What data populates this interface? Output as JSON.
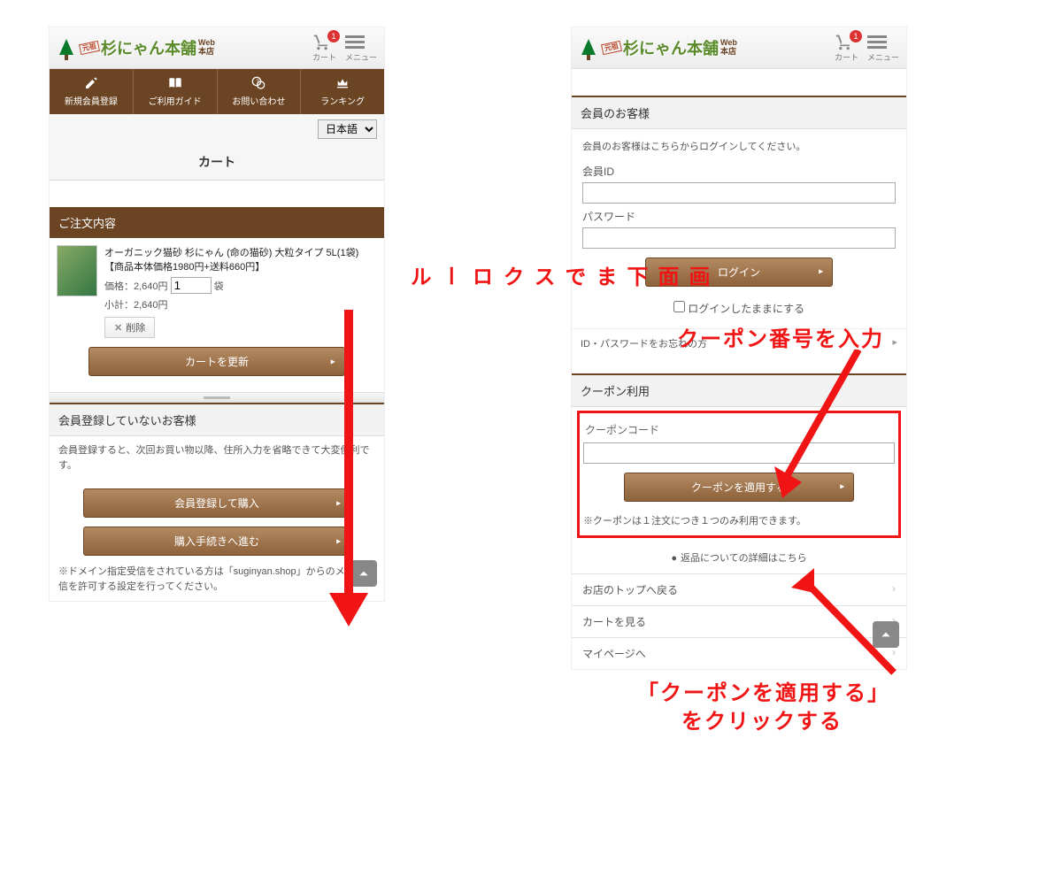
{
  "logo": {
    "prefix": "元祖",
    "main": "杉にゃん本舗",
    "sub_top": "Web",
    "sub_bottom": "本店"
  },
  "topbar": {
    "cart_label": "カート",
    "cart_count": "1",
    "menu_label": "メニュー"
  },
  "nav": {
    "register": "新規会員登録",
    "guide": "ご利用ガイド",
    "contact": "お問い合わせ",
    "ranking": "ランキング"
  },
  "lang": {
    "selected": "日本語"
  },
  "page_title": "カート",
  "order": {
    "heading": "ご注文内容",
    "item_name": "オーガニック猫砂 杉にゃん (命の猫砂) 大粒タイプ 5L(1袋) 【商品本体価格1980円+送料660円】",
    "price_label": "価格：",
    "price": "2,640円",
    "qty": "1",
    "unit": "袋",
    "subtotal_label": "小計：",
    "subtotal": "2,640円",
    "delete_btn": "削除",
    "update_btn": "カートを更新"
  },
  "guest": {
    "heading": "会員登録していないお客様",
    "desc": "会員登録すると、次回お買い物以降、住所入力を省略できて大変便利です。",
    "register_btn": "会員登録して購入",
    "proceed_btn": "購入手続きへ進む",
    "domain_note": "※ドメイン指定受信をされている方は「suginyan.shop」からのメール受信を許可する設定を行ってください。"
  },
  "member": {
    "heading": "会員のお客様",
    "instruction": "会員のお客様はこちらからログインしてください。",
    "id_label": "会員ID",
    "pw_label": "パスワード",
    "login_btn": "ログイン",
    "stay_label": "ログインしたままにする",
    "forgot": "ID・パスワードをお忘れの方"
  },
  "coupon": {
    "heading": "クーポン利用",
    "code_label": "クーポンコード",
    "apply_btn": "クーポンを適用する",
    "note": "※クーポンは１注文につき１つのみ利用できます。"
  },
  "returns_link": "返品についての詳細はこちら",
  "footer": {
    "top": "お店のトップへ戻る",
    "cart": "カートを見る",
    "mypage": "マイページへ"
  },
  "annotations": {
    "scroll": "画面下までスクロール",
    "enter_coupon": "クーポン番号を入力",
    "click_apply_l1": "「クーポンを適用する」",
    "click_apply_l2": "をクリックする"
  }
}
